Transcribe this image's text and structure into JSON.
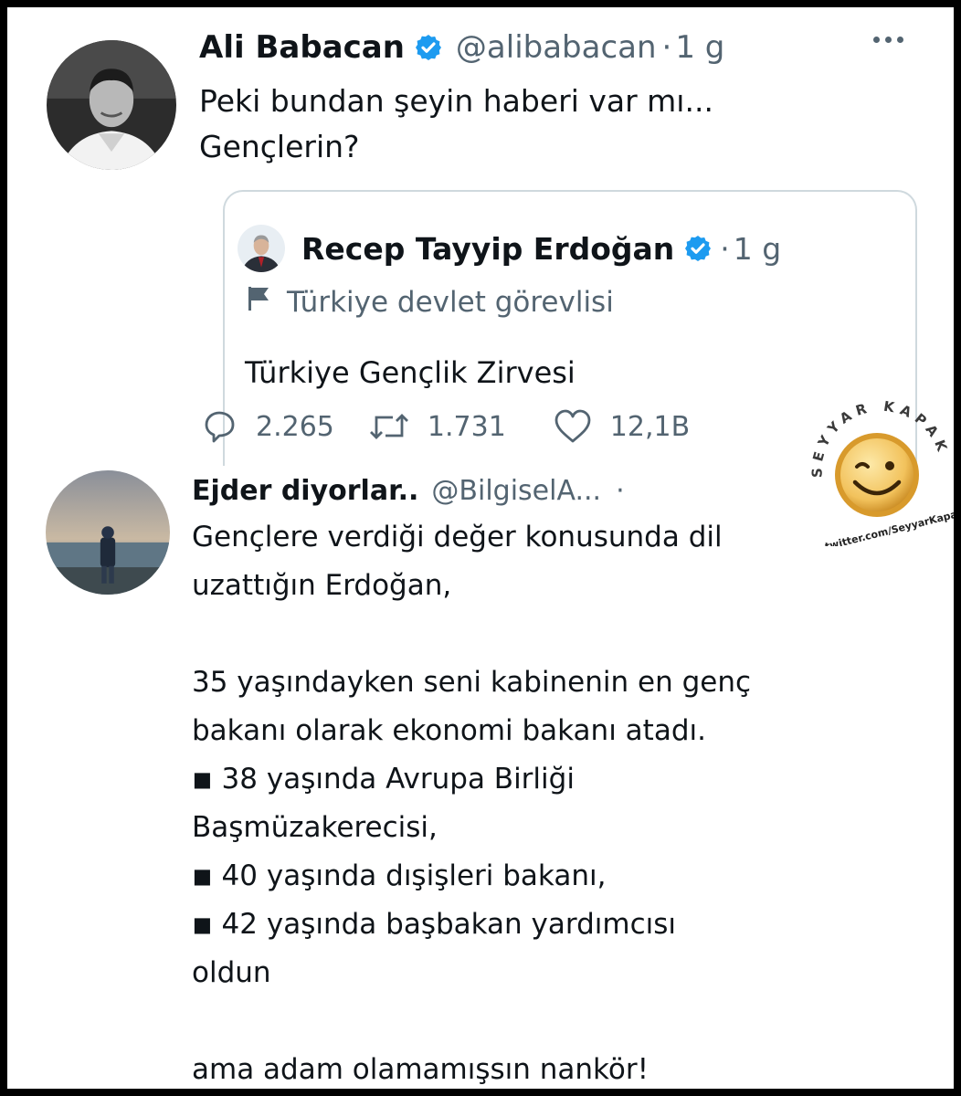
{
  "main_tweet": {
    "display_name": "Ali Babacan",
    "handle": "@alibabacan",
    "separator": "·",
    "time": "1 g",
    "text": "Peki bundan şeyin haberi var mı...\nGençlerin?"
  },
  "quoted_tweet": {
    "display_name": "Recep Tayyip Erdoğan",
    "separator": "·",
    "time": "1 g",
    "label": "Türkiye devlet görevlisi",
    "text": "Türkiye Gençlik Zirvesi"
  },
  "actions": {
    "reply_count": "2.265",
    "retweet_count": "1.731",
    "like_count": "12,1B"
  },
  "reply_tweet": {
    "display_name": "Ejder diyorlar..",
    "handle": "@BilgiselA...",
    "separator": "·",
    "text": "Gençlere verdiği değer konusunda dil\nuzattığın Erdoğan,\n\n35 yaşındayken seni kabinenin en genç\nbakanı olarak ekonomi bakanı atadı.\n ◾ 38 yaşında Avrupa Birliği\nBaşmüzakerecisi,\n ◾ 40 yaşında dışişleri bakanı,\n ◾ 42 yaşında başbakan yardımcısı\noldun\n\nama adam olamamışsın nankör!"
  },
  "watermark": {
    "arc_text": "SEYYAR KAPAKÇI",
    "url": "twitter.com/SeyyarKapakci"
  },
  "colors": {
    "verified": "#1d9bf0",
    "muted": "#536471",
    "border": "#cfd9de"
  }
}
